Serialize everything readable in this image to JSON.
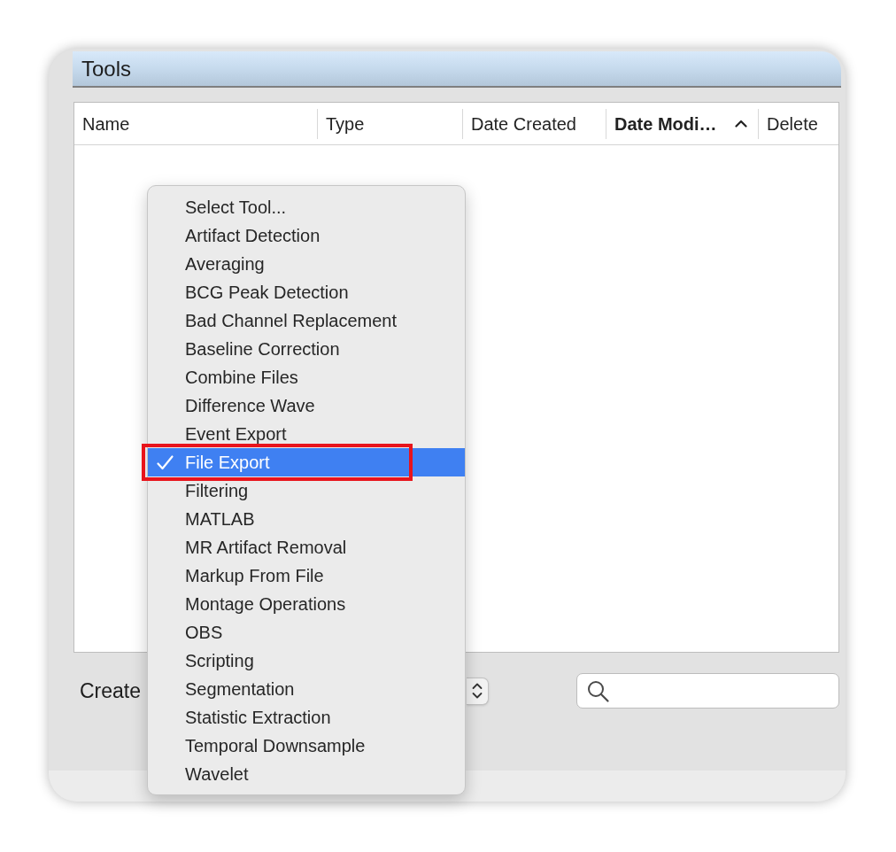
{
  "window": {
    "title": "Tools"
  },
  "table": {
    "columns": [
      {
        "label": "Name",
        "sorted": false
      },
      {
        "label": "Type",
        "sorted": false
      },
      {
        "label": "Date Created",
        "sorted": false
      },
      {
        "label": "Date Modi…",
        "sorted": true
      },
      {
        "label": "Delete",
        "sorted": false
      }
    ]
  },
  "footer": {
    "create_label": "Create"
  },
  "menu": {
    "items": [
      {
        "label": "Select Tool...",
        "selected": false,
        "highlighted": false
      },
      {
        "label": "Artifact Detection",
        "selected": false,
        "highlighted": false
      },
      {
        "label": "Averaging",
        "selected": false,
        "highlighted": false
      },
      {
        "label": "BCG Peak Detection",
        "selected": false,
        "highlighted": false
      },
      {
        "label": "Bad Channel Replacement",
        "selected": false,
        "highlighted": false
      },
      {
        "label": "Baseline Correction",
        "selected": false,
        "highlighted": false
      },
      {
        "label": "Combine Files",
        "selected": false,
        "highlighted": false
      },
      {
        "label": "Difference Wave",
        "selected": false,
        "highlighted": false
      },
      {
        "label": "Event Export",
        "selected": false,
        "highlighted": false
      },
      {
        "label": "File Export",
        "selected": true,
        "highlighted": true
      },
      {
        "label": "Filtering",
        "selected": false,
        "highlighted": false
      },
      {
        "label": "MATLAB",
        "selected": false,
        "highlighted": false
      },
      {
        "label": "MR Artifact Removal",
        "selected": false,
        "highlighted": false
      },
      {
        "label": "Markup From File",
        "selected": false,
        "highlighted": false
      },
      {
        "label": "Montage Operations",
        "selected": false,
        "highlighted": false
      },
      {
        "label": "OBS",
        "selected": false,
        "highlighted": false
      },
      {
        "label": "Scripting",
        "selected": false,
        "highlighted": false
      },
      {
        "label": "Segmentation",
        "selected": false,
        "highlighted": false
      },
      {
        "label": "Statistic Extraction",
        "selected": false,
        "highlighted": false
      },
      {
        "label": "Temporal Downsample",
        "selected": false,
        "highlighted": false
      },
      {
        "label": "Wavelet",
        "selected": false,
        "highlighted": false
      }
    ]
  }
}
